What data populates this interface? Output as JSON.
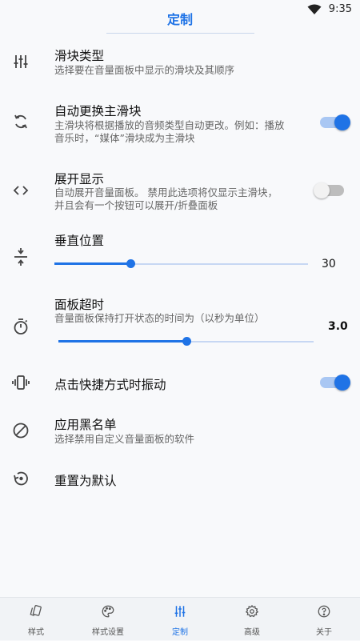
{
  "status": {
    "time": "9:35"
  },
  "header": {
    "title": "定制"
  },
  "settings": [
    {
      "icon": "sliders-icon",
      "title": "滑块类型",
      "subtitle": [
        "选择要在音量面板中显示的滑块及其顺序"
      ]
    },
    {
      "icon": "sync-icon",
      "title": "自动更换主滑块",
      "subtitle": [
        "主滑块将根据播放的音频类型自动更改。例如：播放",
        "音乐时，“媒体”滑块成为主滑块"
      ],
      "toggle": true
    },
    {
      "icon": "code-icon",
      "title": "展开显示",
      "subtitle": [
        "自动展开音量面板。 禁用此选项将仅显示主滑块，",
        "并且会有一个按钮可以展开/折叠面板"
      ],
      "toggle": false
    },
    {
      "icon": "vertical-align-icon",
      "title": "垂直位置",
      "slider": {
        "value": 30,
        "min": 0,
        "max": 100,
        "label": "30"
      }
    },
    {
      "icon": "timer-icon",
      "title": "面板超时",
      "subtitle": [
        "音量面板保持打开状态的时间为（以秒为单位）"
      ],
      "slider": {
        "value": 3.0,
        "min": 0,
        "max": 6,
        "label": "3.0"
      }
    },
    {
      "icon": "vibrate-icon",
      "title": "点击快捷方式时振动",
      "toggle": true
    },
    {
      "icon": "block-icon",
      "title": "应用黑名单",
      "subtitle": [
        "选择禁用自定义音量面板的软件"
      ]
    },
    {
      "icon": "restore-icon",
      "title": "重置为默认"
    }
  ],
  "bottom_nav": [
    {
      "icon": "style-icon",
      "label": "样式",
      "active": false
    },
    {
      "icon": "palette-icon",
      "label": "样式设置",
      "active": false
    },
    {
      "icon": "tune-icon",
      "label": "定制",
      "active": true
    },
    {
      "icon": "gear-icon",
      "label": "高级",
      "active": false
    },
    {
      "icon": "help-icon",
      "label": "关于",
      "active": false
    }
  ],
  "colors": {
    "accent": "#1f73e6",
    "background": "#f8f9fb"
  }
}
